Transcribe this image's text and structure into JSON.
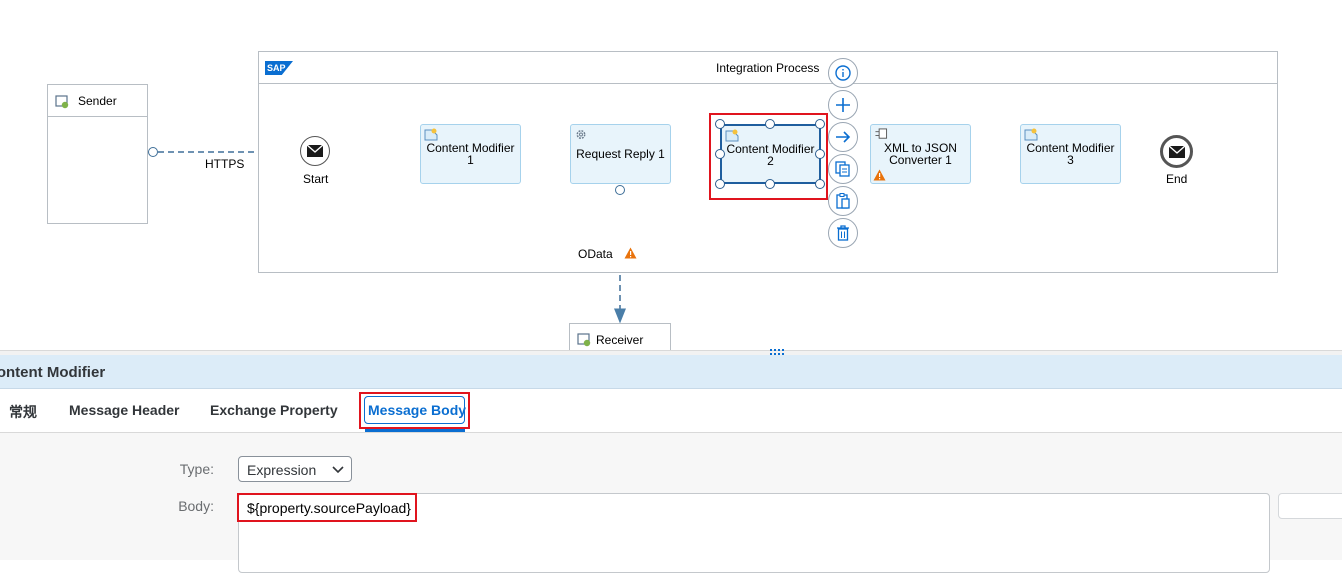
{
  "diagram": {
    "sender_label": "Sender",
    "receiver_label": "Receiver",
    "pool_title": "Integration Process",
    "sap_logo_text": "SAP",
    "https_label": "HTTPS",
    "odata_label": "OData",
    "start_label": "Start",
    "end_label": "End",
    "nodes": {
      "content_modifier_1": "Content Modifier\n1",
      "request_reply_1": "Request Reply 1",
      "content_modifier_2": "Content Modifier\n2",
      "xml_to_json_1": "XML to JSON\nConverter 1",
      "content_modifier_3": "Content Modifier\n3"
    },
    "context_buttons": [
      "info-icon",
      "add-icon",
      "connect-arrow-icon",
      "copy-icon",
      "paste-icon",
      "delete-icon"
    ]
  },
  "panel": {
    "title": "Content Modifier",
    "tabs": [
      {
        "label": "常规"
      },
      {
        "label": "Message Header"
      },
      {
        "label": "Exchange Property"
      },
      {
        "label": "Message Body"
      }
    ],
    "active_tab": "Message Body",
    "type_label": "Type:",
    "type_value": "Expression",
    "body_label": "Body:",
    "body_value": "${property.sourcePayload}"
  },
  "colors": {
    "accent": "#0a6ed1",
    "node_fill": "#e8f4fb",
    "node_border": "#a6d2ec",
    "highlight": "#e0141e",
    "warning": "#e9730c"
  }
}
